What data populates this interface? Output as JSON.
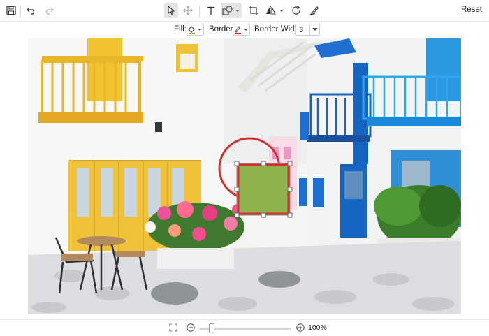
{
  "toolbar": {
    "save_icon": "save-icon",
    "undo_icon": "undo-icon",
    "redo_icon": "redo-icon",
    "select_icon": "pointer-icon",
    "pan_icon": "move-icon",
    "text_icon": "text-icon",
    "shapes_icon": "shapes-icon",
    "crop_icon": "crop-icon",
    "flip_icon": "flip-icon",
    "rotate_icon": "rotate-icon",
    "draw_icon": "pen-icon",
    "reset_label": "Reset"
  },
  "properties": {
    "fill_label": "Fill:",
    "fill_color": "#8fb24e",
    "border_label": "Border:",
    "border_color": "#d32f2f",
    "border_width_label": "Border Width:",
    "border_width_value": "3"
  },
  "canvas": {
    "image_subject": "whitewashed street with yellow and blue balconies and flowers",
    "annotations": [
      {
        "type": "circle",
        "stroke": "#d32f2f",
        "selected": false
      },
      {
        "type": "rectangle",
        "fill": "#8fb24e",
        "stroke": "#d32f2f",
        "selected": true
      }
    ]
  },
  "zoom": {
    "fit_icon": "fit-screen-icon",
    "zoom_out_icon": "zoom-out-icon",
    "zoom_in_icon": "zoom-in-icon",
    "level": 0.15,
    "label": "100%"
  }
}
